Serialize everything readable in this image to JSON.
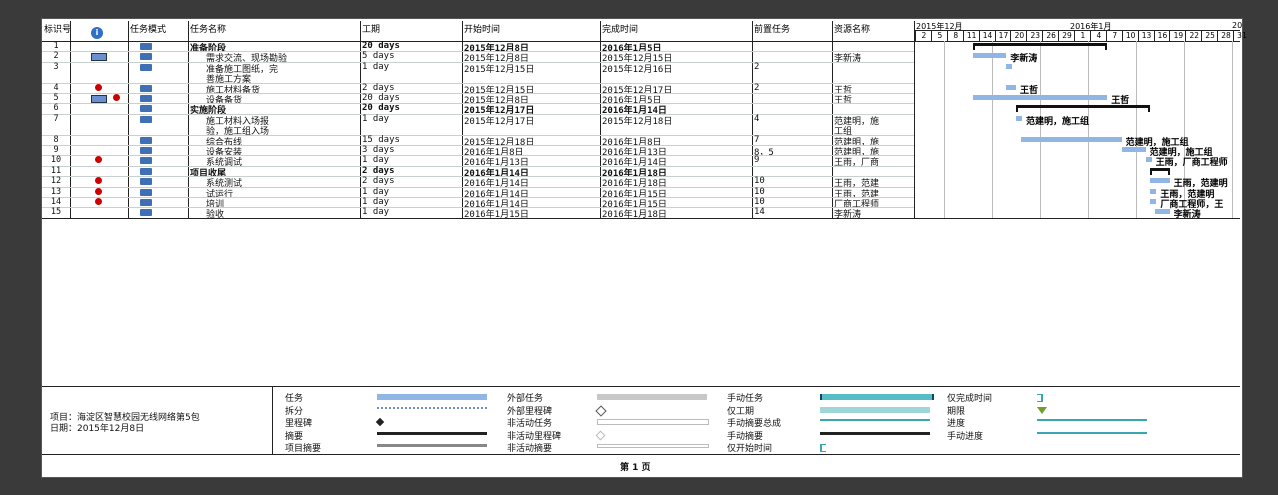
{
  "headers": {
    "id": "标识号",
    "info": "i",
    "mode": "任务模式",
    "name": "任务名称",
    "duration": "工期",
    "start": "开始时间",
    "finish": "完成时间",
    "pred": "前置任务",
    "resource": "资源名称"
  },
  "timeline": {
    "month1": "2015年12月",
    "month2": "2016年1月",
    "month3": "20",
    "days": [
      "2",
      "5",
      "8",
      "11",
      "14",
      "17",
      "20",
      "23",
      "26",
      "29",
      "1",
      "4",
      "7",
      "10",
      "13",
      "16",
      "19",
      "22",
      "25",
      "28",
      "31"
    ]
  },
  "rows": [
    {
      "id": "1",
      "name": "准备阶段",
      "duration": "20 days",
      "start": "2015年12月8日",
      "finish": "2016年1月5日",
      "pred": "",
      "resource": "",
      "bold": true,
      "ind": ""
    },
    {
      "id": "2",
      "name": "需求交流、现场勘验",
      "duration": "5 days",
      "start": "2015年12月8日",
      "finish": "2015年12月15日",
      "pred": "",
      "resource": "李新涛",
      "bold": false,
      "ind": "calendar"
    },
    {
      "id": "3",
      "name": "准备施工图纸，完",
      "name2": "善施工方案",
      "duration": "1 day",
      "start": "2015年12月15日",
      "finish": "2015年12月16日",
      "pred": "2",
      "resource": "",
      "bold": false,
      "ind": ""
    },
    {
      "id": "4",
      "name": "施工材料备货",
      "duration": "2 days",
      "start": "2015年12月15日",
      "finish": "2015年12月17日",
      "pred": "2",
      "resource": "王哲",
      "bold": false,
      "ind": "pin"
    },
    {
      "id": "5",
      "name": "设备备货",
      "duration": "20 days",
      "start": "2015年12月8日",
      "finish": "2016年1月5日",
      "pred": "",
      "resource": "王哲",
      "bold": false,
      "ind": "calendar-pin"
    },
    {
      "id": "6",
      "name": "实施阶段",
      "duration": "20 days",
      "start": "2015年12月17日",
      "finish": "2016年1月14日",
      "pred": "",
      "resource": "",
      "bold": true,
      "ind": ""
    },
    {
      "id": "7",
      "name": "施工材料入场报",
      "name2": "验，施工组入场",
      "duration": "1 day",
      "start": "2015年12月17日",
      "finish": "2015年12月18日",
      "pred": "4",
      "resource": "范建明，施",
      "resource2": "工组",
      "bold": false,
      "ind": ""
    },
    {
      "id": "8",
      "name": "综合布线",
      "duration": "15 days",
      "start": "2015年12月18日",
      "finish": "2016年1月8日",
      "pred": "7",
      "resource": "范建明，施",
      "bold": false,
      "ind": ""
    },
    {
      "id": "9",
      "name": "设备安装",
      "duration": "3 days",
      "start": "2016年1月8日",
      "finish": "2016年1月13日",
      "pred": "8，5",
      "resource": "范建明，施",
      "bold": false,
      "ind": ""
    },
    {
      "id": "10",
      "name": "系统调试",
      "duration": "1 day",
      "start": "2016年1月13日",
      "finish": "2016年1月14日",
      "pred": "9",
      "resource": "王雨，厂商",
      "bold": false,
      "ind": "pin"
    },
    {
      "id": "11",
      "name": "项目收尾",
      "duration": "2 days",
      "start": "2016年1月14日",
      "finish": "2016年1月18日",
      "pred": "",
      "resource": "",
      "bold": true,
      "ind": ""
    },
    {
      "id": "12",
      "name": "系统测试",
      "duration": "2 days",
      "start": "2016年1月14日",
      "finish": "2016年1月18日",
      "pred": "10",
      "resource": "王雨，范建",
      "bold": false,
      "ind": "pin"
    },
    {
      "id": "13",
      "name": "试运行",
      "duration": "1 day",
      "start": "2016年1月14日",
      "finish": "2016年1月15日",
      "pred": "10",
      "resource": "王雨，范建",
      "bold": false,
      "ind": "pin"
    },
    {
      "id": "14",
      "name": "培训",
      "duration": "1 day",
      "start": "2016年1月14日",
      "finish": "2016年1月15日",
      "pred": "10",
      "resource": "厂商工程师",
      "bold": false,
      "ind": "pin"
    },
    {
      "id": "15",
      "name": "验收",
      "duration": "1 day",
      "start": "2016年1月15日",
      "finish": "2016年1月18日",
      "pred": "14",
      "resource": "李新涛",
      "bold": false,
      "ind": ""
    }
  ],
  "gantt_labels": {
    "r2": "李新涛",
    "r4": "王哲",
    "r5": "王哲",
    "r7": "范建明，施工组",
    "r8": "范建明，施工组",
    "r9": "范建明，施工组",
    "r10": "王雨，厂商工程师",
    "r12": "王雨，范建明",
    "r13": "王雨，范建明",
    "r14": "厂商工程师，王",
    "r15": "李新涛"
  },
  "project": {
    "line1": "项目：海淀区智慧校园无线网络第5包",
    "line2": "日期：2015年12月8日"
  },
  "legend": {
    "c1": [
      "任务",
      "拆分",
      "里程碑",
      "摘要",
      "项目摘要"
    ],
    "c2": [
      "外部任务",
      "外部里程碑",
      "非活动任务",
      "非活动里程碑",
      "非活动摘要"
    ],
    "c3": [
      "手动任务",
      "仅工期",
      "手动摘要总成",
      "手动摘要",
      "仅开始时间"
    ],
    "c4": [
      "仅完成时间",
      "期限",
      "进度",
      "手动进度"
    ]
  },
  "footer": "第 1 页",
  "colors": {
    "bar": "#8fb6e5",
    "pin": "#cc0000",
    "teal": "#3aa6b0",
    "manual": "#56bcc6"
  }
}
